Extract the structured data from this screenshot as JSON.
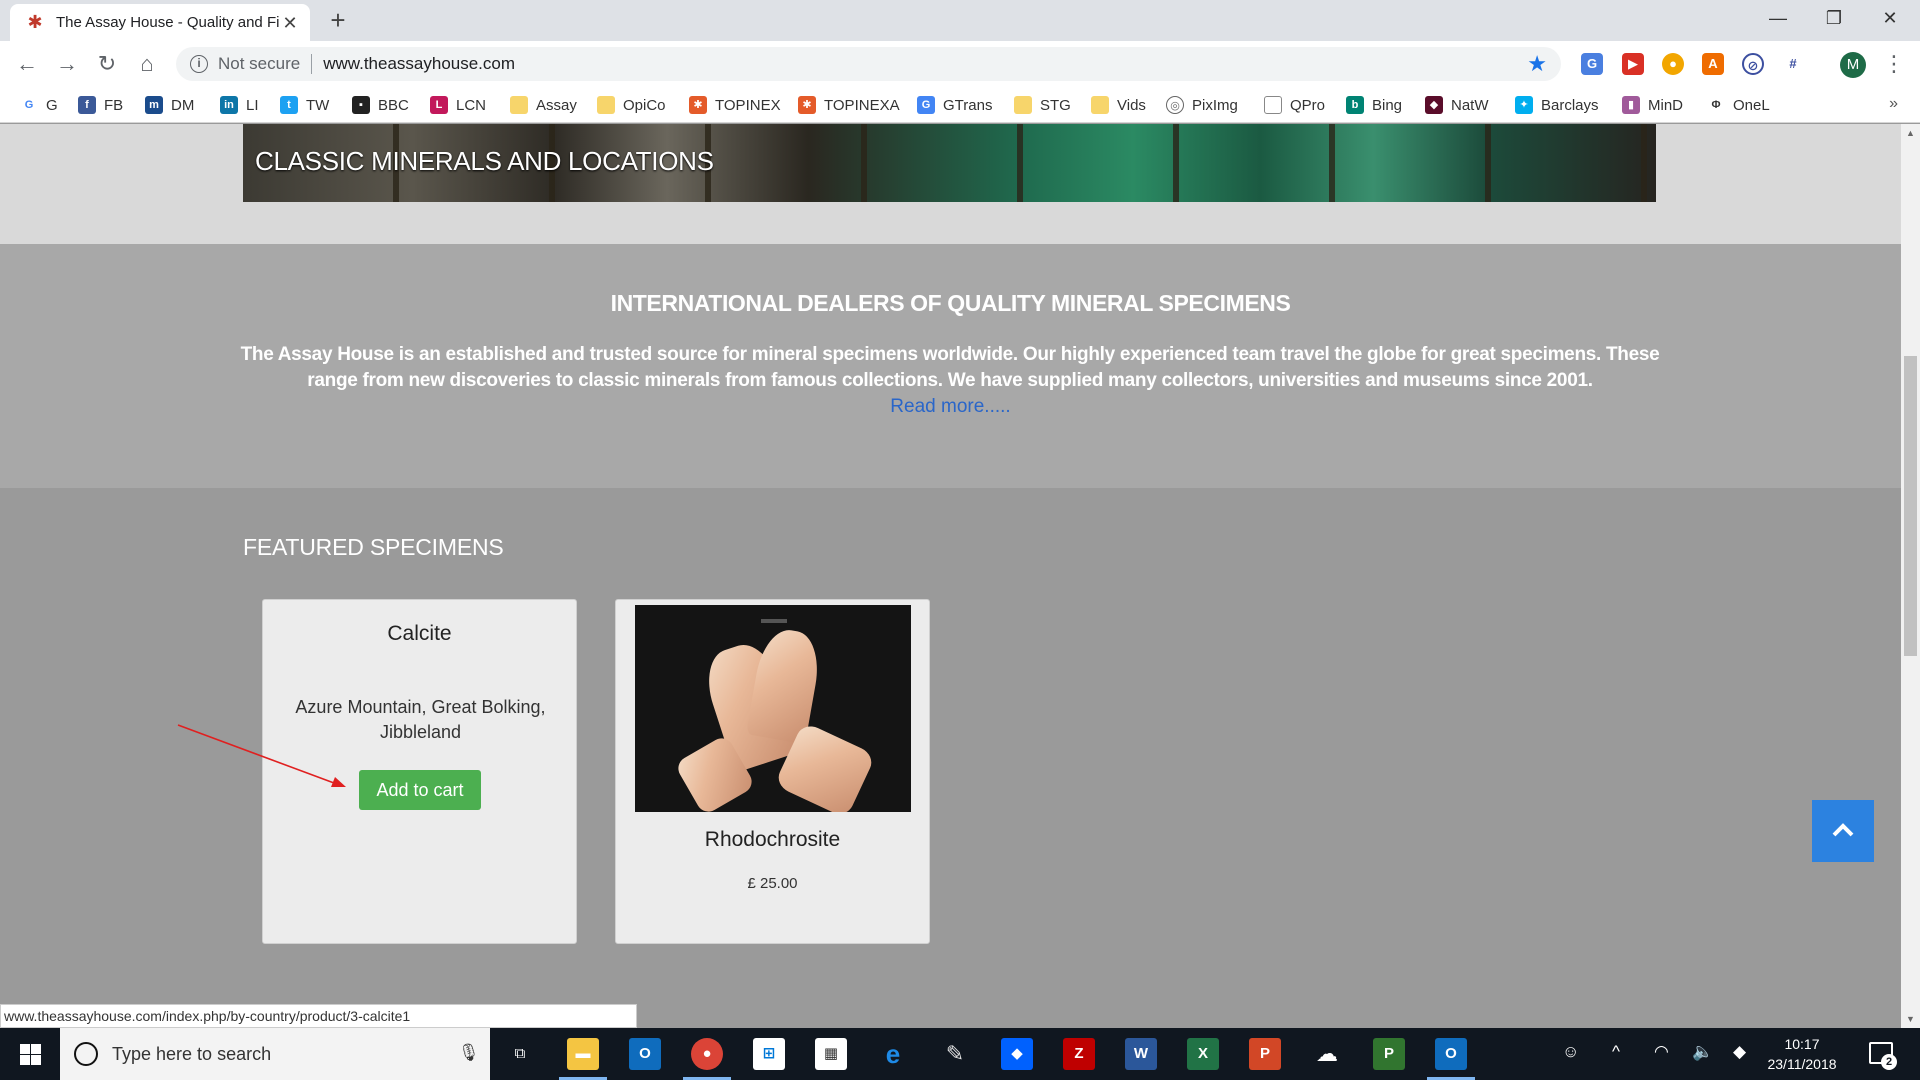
{
  "browser": {
    "tab_title": "The Assay House - Quality and Fi",
    "tab_close": "✕",
    "new_tab": "+",
    "omnibox": {
      "security_label": "Not secure",
      "url": "www.theassayhouse.com"
    },
    "avatar_letter": "M",
    "bookmarks": [
      {
        "label": "G",
        "icon": "google-icon",
        "color": "#4285f4"
      },
      {
        "label": "FB",
        "icon": "facebook-icon",
        "color": "#3b5998"
      },
      {
        "label": "DM",
        "icon": "dm-icon",
        "color": "#1b4c8c"
      },
      {
        "label": "LI",
        "icon": "linkedin-icon",
        "color": "#0e76a8"
      },
      {
        "label": "TW",
        "icon": "twitter-icon",
        "color": "#1da1f2"
      },
      {
        "label": "BBC",
        "icon": "bbc-icon",
        "color": "#222222"
      },
      {
        "label": "LCN",
        "icon": "lcn-icon",
        "color": "#c2185b"
      },
      {
        "label": "Assay",
        "icon": "folder-icon",
        "color": "#f7d56b"
      },
      {
        "label": "OpiCo",
        "icon": "folder-icon",
        "color": "#f7d56b"
      },
      {
        "label": "TOPINEX",
        "icon": "joomla-icon",
        "color": "#e45b2a"
      },
      {
        "label": "TOPINEXA",
        "icon": "joomla-icon",
        "color": "#e45b2a"
      },
      {
        "label": "GTrans",
        "icon": "translate-icon",
        "color": "#4285f4"
      },
      {
        "label": "STG",
        "icon": "folder-icon",
        "color": "#f7d56b"
      },
      {
        "label": "Vids",
        "icon": "folder-icon",
        "color": "#f7d56b"
      },
      {
        "label": "PixImg",
        "icon": "globe-icon",
        "color": "#666666"
      },
      {
        "label": "QPro",
        "icon": "page-icon",
        "color": "#888888"
      },
      {
        "label": "Bing",
        "icon": "bing-icon",
        "color": "#008373"
      },
      {
        "label": "NatW",
        "icon": "natwest-icon",
        "color": "#5a0d2a"
      },
      {
        "label": "Barclays",
        "icon": "barclays-icon",
        "color": "#00aeef"
      },
      {
        "label": "MinD",
        "icon": "mind-icon",
        "color": "#a05a9a"
      },
      {
        "label": "OneL",
        "icon": "onel-icon",
        "color": "#333333"
      }
    ],
    "bookmarks_more": "»",
    "status_url": "www.theassayhouse.com/index.php/by-country/product/3-calcite1"
  },
  "page": {
    "banner_title": "CLASSIC MINERALS AND LOCATIONS",
    "intro": {
      "heading": "INTERNATIONAL DEALERS OF QUALITY MINERAL SPECIMENS",
      "text": "The Assay House is an established and trusted source for mineral specimens worldwide. Our highly experienced team travel the globe for great specimens. These range from new discoveries to classic minerals from famous collections. We have supplied many collectors, universities and museums since 2001.",
      "read_more": "Read more....."
    },
    "featured": {
      "heading": "FEATURED SPECIMENS",
      "cards": [
        {
          "name": "Calcite",
          "location": "Azure Mountain, Great Bolking, Jibbleland",
          "button": "Add to cart"
        },
        {
          "name": "Rhodochrosite",
          "price": "£ 25.00"
        }
      ]
    }
  },
  "taskbar": {
    "search_placeholder": "Type here to search",
    "time": "10:17",
    "date": "23/11/2018",
    "notification_count": "2",
    "apps": [
      {
        "icon": "task-view-icon"
      },
      {
        "icon": "file-explorer-icon",
        "color": "#f4c542"
      },
      {
        "icon": "outlook-icon",
        "color": "#0f6cbd"
      },
      {
        "icon": "chrome-icon",
        "color": "#db4437"
      },
      {
        "icon": "store-icon",
        "color": "#ffffff"
      },
      {
        "icon": "calculator-icon",
        "color": "#ffffff"
      },
      {
        "icon": "edge-icon",
        "color": "#1e8ae6"
      },
      {
        "icon": "paint-icon",
        "color": "#e0e0e0"
      },
      {
        "icon": "dropbox-icon",
        "color": "#0061fe"
      },
      {
        "icon": "filezilla-icon",
        "color": "#bf0000"
      },
      {
        "icon": "word-icon",
        "color": "#2b579a"
      },
      {
        "icon": "excel-icon",
        "color": "#217346"
      },
      {
        "icon": "powerpoint-icon",
        "color": "#d24726"
      },
      {
        "icon": "onedrive-icon",
        "color": "#ffffff"
      },
      {
        "icon": "project-icon",
        "color": "#31752f"
      },
      {
        "icon": "outlook-icon",
        "color": "#0f6cbd"
      }
    ]
  },
  "colors": {
    "add_to_cart": "#4caf50",
    "link": "#2a66c9",
    "back_to_top": "#2c82e0",
    "annotation_arrow": "#e02020"
  }
}
